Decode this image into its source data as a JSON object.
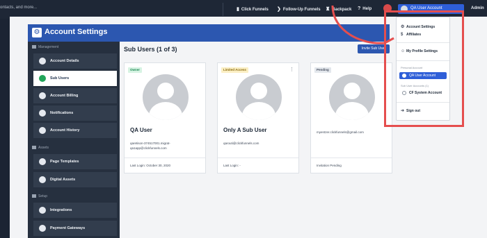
{
  "topbar": {
    "search_text": "ontacts, and more...",
    "items": [
      {
        "icon": "funnel-icon",
        "glyph": "▮",
        "label": "Click Funnels"
      },
      {
        "icon": "follow-up-icon",
        "glyph": "❯",
        "label": "Follow-Up Funnels"
      },
      {
        "icon": "backpack-icon",
        "glyph": "♜",
        "label": "Backpack"
      },
      {
        "icon": "help-icon",
        "glyph": "?",
        "label": "Help"
      }
    ],
    "user_label": "QA User Account",
    "admin_label": "Admin"
  },
  "header": {
    "title": "Account Settings"
  },
  "sidebar": {
    "sections": [
      {
        "heading": "Management",
        "items": [
          {
            "label": "Account Details",
            "active": false
          },
          {
            "label": "Sub Users",
            "active": true
          },
          {
            "label": "Account Billing",
            "active": false
          },
          {
            "label": "Notifications",
            "active": false
          },
          {
            "label": "Account History",
            "active": false
          }
        ]
      },
      {
        "heading": "Assets",
        "items": [
          {
            "label": "Page Templates",
            "active": false
          },
          {
            "label": "Digital Assets",
            "active": false
          }
        ]
      },
      {
        "heading": "Setup",
        "items": [
          {
            "label": "Integrations",
            "active": false
          },
          {
            "label": "Payment Gateways",
            "active": false
          }
        ]
      }
    ]
  },
  "main": {
    "title": "Sub Users (1 of 3)",
    "invite_button": "Invite Sub User",
    "cards": [
      {
        "badge": "Owner",
        "badge_bg": "#d7f3e3",
        "badge_fg": "#1f8a55",
        "name": "QA User",
        "email": "qaretison-374517001.migrat-qa1app@clickfunnels.com",
        "footer": "Last Login: October 30, 2020",
        "menu": false
      },
      {
        "badge": "Limited Access",
        "badge_bg": "#fbefc4",
        "badge_fg": "#8a6a10",
        "name": "Only A Sub User",
        "email": "qarouti@clickfunnels.com",
        "footer": "Last Login: -",
        "menu": true
      },
      {
        "badge": "Pending",
        "badge_bg": "#e3e7ec",
        "badge_fg": "#4a5262",
        "name": "",
        "email": "myentzer.clickfunnels@gmail.com",
        "footer": "Invitation Pending",
        "menu": true
      }
    ]
  },
  "dropdown": {
    "items_top": [
      {
        "icon": "gear-icon",
        "glyph": "⚙",
        "label": "Account Settings"
      },
      {
        "icon": "dollar-icon",
        "glyph": "$",
        "label": "Affiliates"
      }
    ],
    "profile_item": {
      "icon": "person-icon",
      "glyph": "☺",
      "label": "My Profile Settings"
    },
    "personal_heading": "Personal Account",
    "personal_active": "QA User Account",
    "sub_heading": "Sub User Accounts (1)",
    "sub_account": "CF System Account",
    "signout": {
      "icon": "signout-icon",
      "glyph": "➜",
      "label": "Sign out"
    }
  },
  "colors": {
    "accent": "#2c57b0",
    "highlight": "#e54e4e",
    "active_green": "#22a55a"
  }
}
